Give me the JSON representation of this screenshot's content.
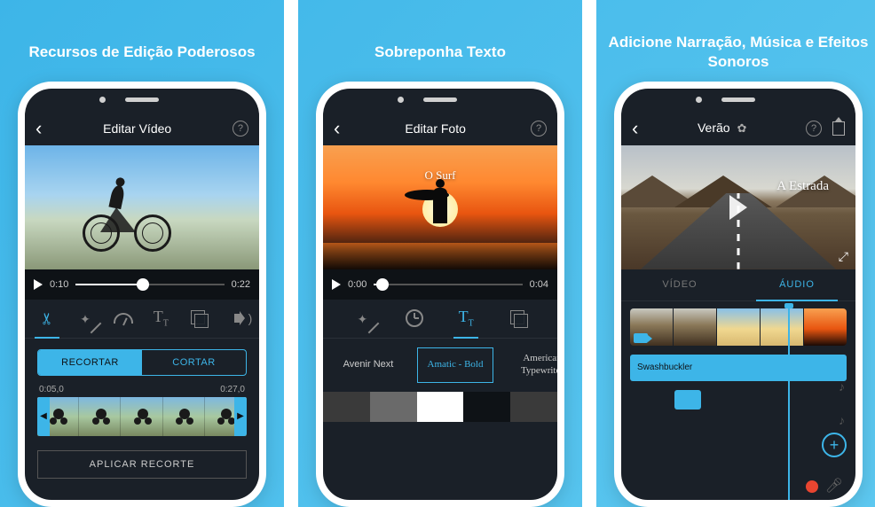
{
  "headlines": {
    "panel1": "Recursos de Edição Poderosos",
    "panel2": "Sobreponha Texto",
    "panel3": "Adicione Narração, Música e Efeitos Sonoros"
  },
  "panel1": {
    "nav_title": "Editar Vídeo",
    "time_current": "0:10",
    "time_total": "0:22",
    "scrub_percent": 45,
    "tools": [
      "scissors",
      "wand",
      "gauge",
      "text",
      "layers",
      "speaker"
    ],
    "active_tool": "scissors",
    "segments": {
      "a": "RECORTAR",
      "b": "CORTAR",
      "active": "a"
    },
    "strip": {
      "start": "0:05,0",
      "end": "0:27,0",
      "frames": 5
    },
    "apply_label": "APLICAR RECORTE"
  },
  "panel2": {
    "nav_title": "Editar Foto",
    "overlay_text": "O Surf",
    "time_current": "0:00",
    "time_total": "0:04",
    "scrub_percent": 6,
    "tools": [
      "wand",
      "clock",
      "text",
      "layers"
    ],
    "active_tool": "text",
    "fonts": [
      {
        "label": "Avenir Next"
      },
      {
        "label": "Amatic - Bold",
        "selected": true
      },
      {
        "label": "American Typewriter"
      }
    ],
    "swatches": [
      "#3a3a3a",
      "#6a6a6a",
      "#ffffff",
      "#0e1216",
      "#3a3a3a"
    ]
  },
  "panel3": {
    "nav_title": "Verão",
    "overlay_text": "A Estrada",
    "tabs": {
      "a": "VÍDEO",
      "b": "ÁUDIO",
      "active": "b"
    },
    "audio_clip_label": "Swashbuckler"
  }
}
